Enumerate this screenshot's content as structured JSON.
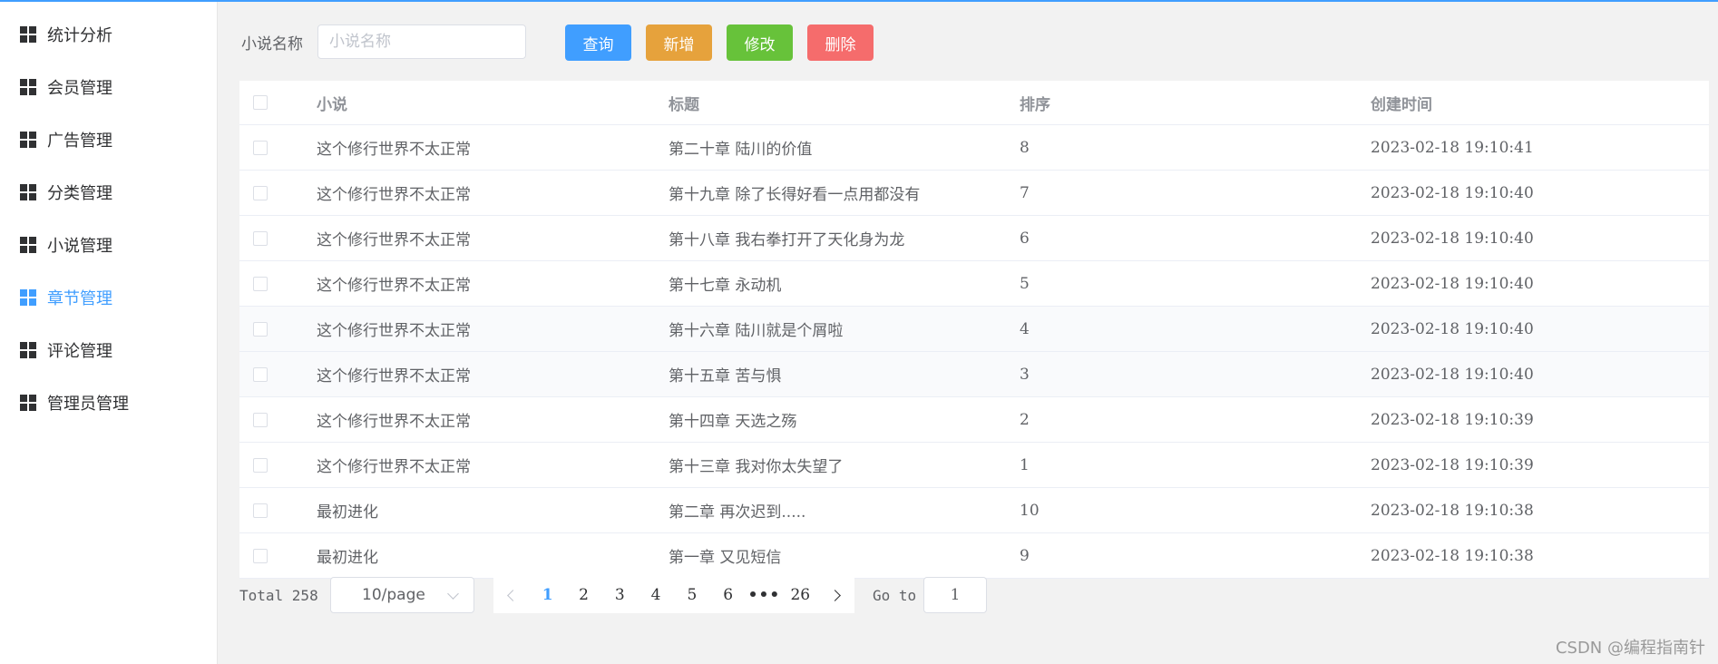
{
  "sidebar": {
    "items": [
      {
        "label": "统计分析",
        "icon": "grid-icon",
        "active": false
      },
      {
        "label": "会员管理",
        "icon": "grid-icon",
        "active": false
      },
      {
        "label": "广告管理",
        "icon": "grid-icon",
        "active": false
      },
      {
        "label": "分类管理",
        "icon": "grid-icon",
        "active": false
      },
      {
        "label": "小说管理",
        "icon": "grid-icon",
        "active": false
      },
      {
        "label": "章节管理",
        "icon": "grid-icon",
        "active": true
      },
      {
        "label": "评论管理",
        "icon": "grid-icon",
        "active": false
      },
      {
        "label": "管理员管理",
        "icon": "grid-icon",
        "active": false
      }
    ]
  },
  "search": {
    "label": "小说名称",
    "placeholder": "小说名称",
    "value": ""
  },
  "toolbar": {
    "query_label": "查询",
    "add_label": "新增",
    "edit_label": "修改",
    "delete_label": "删除"
  },
  "colors": {
    "accent": "#409eff",
    "warning": "#e6a23c",
    "success": "#67c23a",
    "danger": "#f56c6c"
  },
  "table": {
    "headers": [
      "小说",
      "标题",
      "排序",
      "创建时间"
    ],
    "rows": [
      {
        "novel": "这个修行世界不太正常",
        "title": "第二十章 陆川的价值",
        "order": "8",
        "created": "2023-02-18 19:10:41"
      },
      {
        "novel": "这个修行世界不太正常",
        "title": "第十九章 除了长得好看一点用都没有",
        "order": "7",
        "created": "2023-02-18 19:10:40"
      },
      {
        "novel": "这个修行世界不太正常",
        "title": "第十八章 我右拳打开了天化身为龙",
        "order": "6",
        "created": "2023-02-18 19:10:40"
      },
      {
        "novel": "这个修行世界不太正常",
        "title": "第十七章 永动机",
        "order": "5",
        "created": "2023-02-18 19:10:40"
      },
      {
        "novel": "这个修行世界不太正常",
        "title": "第十六章 陆川就是个屑啦",
        "order": "4",
        "created": "2023-02-18 19:10:40"
      },
      {
        "novel": "这个修行世界不太正常",
        "title": "第十五章 苦与惧",
        "order": "3",
        "created": "2023-02-18 19:10:40"
      },
      {
        "novel": "这个修行世界不太正常",
        "title": "第十四章 天选之殇",
        "order": "2",
        "created": "2023-02-18 19:10:39"
      },
      {
        "novel": "这个修行世界不太正常",
        "title": "第十三章 我对你太失望了",
        "order": "1",
        "created": "2023-02-18 19:10:39"
      },
      {
        "novel": "最初进化",
        "title": "第二章 再次迟到.....",
        "order": "10",
        "created": "2023-02-18 19:10:38"
      },
      {
        "novel": "最初进化",
        "title": "第一章 又见短信",
        "order": "9",
        "created": "2023-02-18 19:10:38"
      }
    ]
  },
  "pagination": {
    "total_label": "Total 258",
    "page_size": "10/page",
    "pages": [
      "1",
      "2",
      "3",
      "4",
      "5",
      "6",
      "•••",
      "26"
    ],
    "current_page": "1",
    "goto_label": "Go to",
    "goto_value": "1"
  },
  "watermark": "CSDN @编程指南针"
}
